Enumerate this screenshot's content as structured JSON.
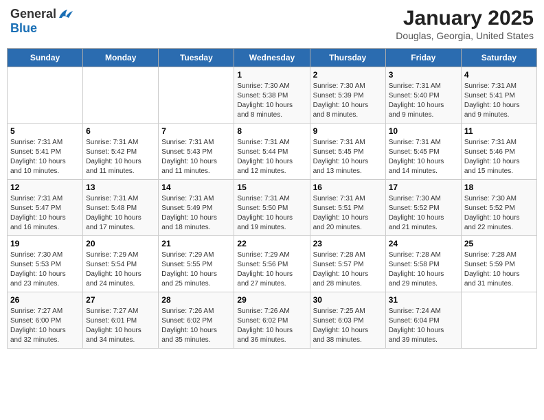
{
  "header": {
    "logo_line1": "General",
    "logo_line2": "Blue",
    "main_title": "January 2025",
    "subtitle": "Douglas, Georgia, United States"
  },
  "days_of_week": [
    "Sunday",
    "Monday",
    "Tuesday",
    "Wednesday",
    "Thursday",
    "Friday",
    "Saturday"
  ],
  "weeks": [
    [
      {
        "day": "",
        "info": ""
      },
      {
        "day": "",
        "info": ""
      },
      {
        "day": "",
        "info": ""
      },
      {
        "day": "1",
        "info": "Sunrise: 7:30 AM\nSunset: 5:38 PM\nDaylight: 10 hours\nand 8 minutes."
      },
      {
        "day": "2",
        "info": "Sunrise: 7:30 AM\nSunset: 5:39 PM\nDaylight: 10 hours\nand 8 minutes."
      },
      {
        "day": "3",
        "info": "Sunrise: 7:31 AM\nSunset: 5:40 PM\nDaylight: 10 hours\nand 9 minutes."
      },
      {
        "day": "4",
        "info": "Sunrise: 7:31 AM\nSunset: 5:41 PM\nDaylight: 10 hours\nand 9 minutes."
      }
    ],
    [
      {
        "day": "5",
        "info": "Sunrise: 7:31 AM\nSunset: 5:41 PM\nDaylight: 10 hours\nand 10 minutes."
      },
      {
        "day": "6",
        "info": "Sunrise: 7:31 AM\nSunset: 5:42 PM\nDaylight: 10 hours\nand 11 minutes."
      },
      {
        "day": "7",
        "info": "Sunrise: 7:31 AM\nSunset: 5:43 PM\nDaylight: 10 hours\nand 11 minutes."
      },
      {
        "day": "8",
        "info": "Sunrise: 7:31 AM\nSunset: 5:44 PM\nDaylight: 10 hours\nand 12 minutes."
      },
      {
        "day": "9",
        "info": "Sunrise: 7:31 AM\nSunset: 5:45 PM\nDaylight: 10 hours\nand 13 minutes."
      },
      {
        "day": "10",
        "info": "Sunrise: 7:31 AM\nSunset: 5:45 PM\nDaylight: 10 hours\nand 14 minutes."
      },
      {
        "day": "11",
        "info": "Sunrise: 7:31 AM\nSunset: 5:46 PM\nDaylight: 10 hours\nand 15 minutes."
      }
    ],
    [
      {
        "day": "12",
        "info": "Sunrise: 7:31 AM\nSunset: 5:47 PM\nDaylight: 10 hours\nand 16 minutes."
      },
      {
        "day": "13",
        "info": "Sunrise: 7:31 AM\nSunset: 5:48 PM\nDaylight: 10 hours\nand 17 minutes."
      },
      {
        "day": "14",
        "info": "Sunrise: 7:31 AM\nSunset: 5:49 PM\nDaylight: 10 hours\nand 18 minutes."
      },
      {
        "day": "15",
        "info": "Sunrise: 7:31 AM\nSunset: 5:50 PM\nDaylight: 10 hours\nand 19 minutes."
      },
      {
        "day": "16",
        "info": "Sunrise: 7:31 AM\nSunset: 5:51 PM\nDaylight: 10 hours\nand 20 minutes."
      },
      {
        "day": "17",
        "info": "Sunrise: 7:30 AM\nSunset: 5:52 PM\nDaylight: 10 hours\nand 21 minutes."
      },
      {
        "day": "18",
        "info": "Sunrise: 7:30 AM\nSunset: 5:52 PM\nDaylight: 10 hours\nand 22 minutes."
      }
    ],
    [
      {
        "day": "19",
        "info": "Sunrise: 7:30 AM\nSunset: 5:53 PM\nDaylight: 10 hours\nand 23 minutes."
      },
      {
        "day": "20",
        "info": "Sunrise: 7:29 AM\nSunset: 5:54 PM\nDaylight: 10 hours\nand 24 minutes."
      },
      {
        "day": "21",
        "info": "Sunrise: 7:29 AM\nSunset: 5:55 PM\nDaylight: 10 hours\nand 25 minutes."
      },
      {
        "day": "22",
        "info": "Sunrise: 7:29 AM\nSunset: 5:56 PM\nDaylight: 10 hours\nand 27 minutes."
      },
      {
        "day": "23",
        "info": "Sunrise: 7:28 AM\nSunset: 5:57 PM\nDaylight: 10 hours\nand 28 minutes."
      },
      {
        "day": "24",
        "info": "Sunrise: 7:28 AM\nSunset: 5:58 PM\nDaylight: 10 hours\nand 29 minutes."
      },
      {
        "day": "25",
        "info": "Sunrise: 7:28 AM\nSunset: 5:59 PM\nDaylight: 10 hours\nand 31 minutes."
      }
    ],
    [
      {
        "day": "26",
        "info": "Sunrise: 7:27 AM\nSunset: 6:00 PM\nDaylight: 10 hours\nand 32 minutes."
      },
      {
        "day": "27",
        "info": "Sunrise: 7:27 AM\nSunset: 6:01 PM\nDaylight: 10 hours\nand 34 minutes."
      },
      {
        "day": "28",
        "info": "Sunrise: 7:26 AM\nSunset: 6:02 PM\nDaylight: 10 hours\nand 35 minutes."
      },
      {
        "day": "29",
        "info": "Sunrise: 7:26 AM\nSunset: 6:02 PM\nDaylight: 10 hours\nand 36 minutes."
      },
      {
        "day": "30",
        "info": "Sunrise: 7:25 AM\nSunset: 6:03 PM\nDaylight: 10 hours\nand 38 minutes."
      },
      {
        "day": "31",
        "info": "Sunrise: 7:24 AM\nSunset: 6:04 PM\nDaylight: 10 hours\nand 39 minutes."
      },
      {
        "day": "",
        "info": ""
      }
    ]
  ]
}
